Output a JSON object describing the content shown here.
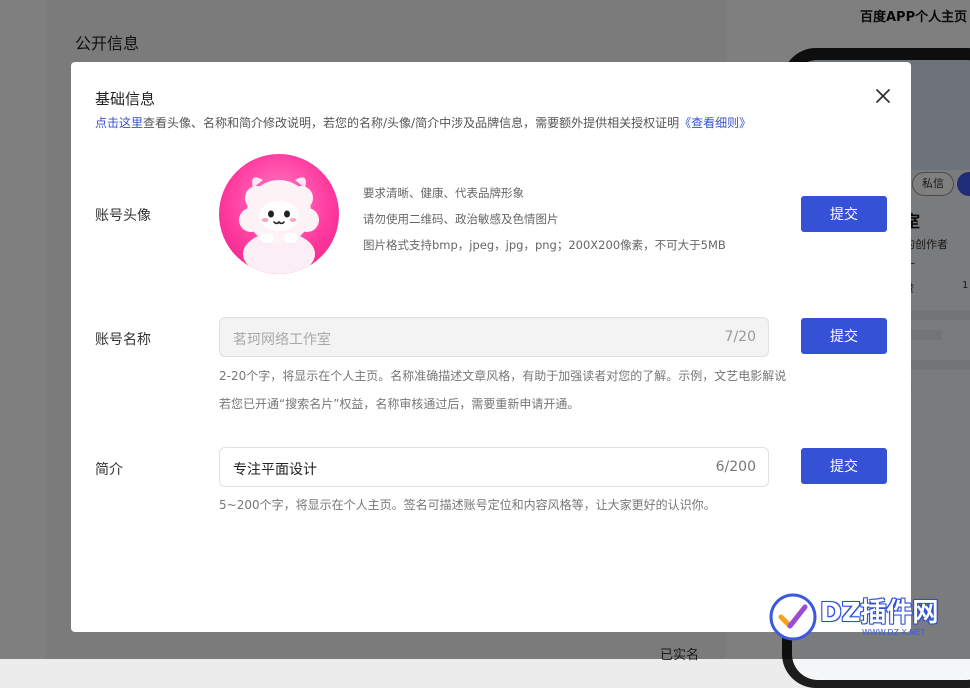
{
  "background": {
    "section_title": "公开信息",
    "right_title": "百度APP个人主页",
    "phone": {
      "private_msg": "私信",
      "name_fragment": "室",
      "desc_fragment": "的创作者",
      "mini1": "十",
      "mini2": "赞",
      "mini3": "1"
    },
    "verified": "已实名"
  },
  "modal": {
    "title": "基础信息",
    "subtitle": {
      "link": "点击这里",
      "text": "查看头像、名称和简介修改说明，若您的名称/头像/简介中涉及品牌信息，需要额外提供相关授权证明",
      "rules_link": "《查看细则》"
    },
    "avatar": {
      "label": "账号头像",
      "tips": [
        "要求清晰、健康、代表品牌形象",
        "请勿使用二维码、政治敏感及色情图片",
        "图片格式支持bmp，jpeg，jpg，png；200X200像素，不可大于5MB"
      ],
      "submit": "提交"
    },
    "name": {
      "label": "账号名称",
      "value": "茗珂网络工作室",
      "count": "7/20",
      "hints": [
        "2-20个字，将显示在个人主页。名称准确描述文章风格，有助于加强读者对您的了解。示例，文艺电影解说",
        "若您已开通“搜索名片”权益，名称审核通过后，需要重新申请开通。"
      ],
      "submit": "提交"
    },
    "intro": {
      "label": "简介",
      "value": "专注平面设计",
      "count": "6/200",
      "hint": "5~200个字，将显示在个人主页。签名可描述账号定位和内容风格等，让大家更好的认识你。",
      "submit": "提交"
    }
  },
  "watermark": {
    "text": "DZ插件网",
    "sub": "WWW.DZ-X.NET"
  },
  "colors": {
    "accent": "#3551d6",
    "overlay": "rgba(0,0,0,0.5)",
    "avatar_pink": "#ff3a9e"
  }
}
